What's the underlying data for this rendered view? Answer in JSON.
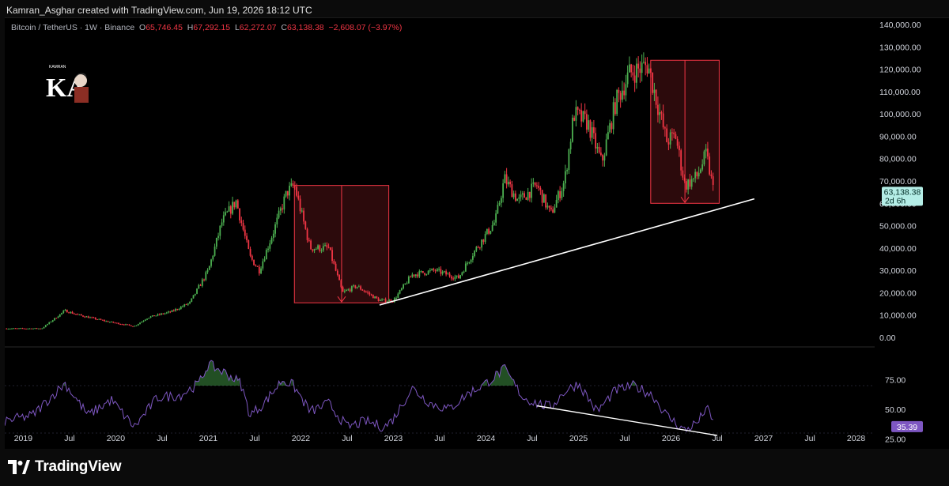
{
  "attribution": "Kamran_Asghar created with TradingView.com, Jun 19, 2026 18:12 UTC",
  "legend": {
    "symbol": "Bitcoin / TetherUS · 1W · Binance",
    "o_label": "O",
    "o_value": "65,746.45",
    "h_label": "H",
    "h_value": "67,292.15",
    "l_label": "L",
    "l_value": "62,272.07",
    "c_label": "C",
    "c_value": "63,138.38",
    "change": "−2,608.07 (−3.97%)"
  },
  "price_badge": {
    "price": "63,138.38",
    "countdown": "2d 6h",
    "color": "#26a69a"
  },
  "rsi_badge": {
    "value": "35.39",
    "color": "#7e57c2"
  },
  "footer": {
    "brand": "TradingView"
  },
  "logo": {
    "text": "KA",
    "small": "KAMRAN"
  },
  "colors": {
    "up": "#4caf50",
    "down": "#f23645",
    "rsi": "#7e57c2",
    "box": "#f23645",
    "trendline": "#ffffff"
  },
  "chart_data": [
    {
      "type": "candlestick",
      "title": "Bitcoin / TetherUS · 1W · Binance",
      "ylim": [
        0,
        140000
      ],
      "y_ticks": [
        "140,000.00",
        "130,000.00",
        "120,000.00",
        "110,000.00",
        "100,000.00",
        "90,000.00",
        "80,000.00",
        "70,000.00",
        "60,000.00",
        "50,000.00",
        "40,000.00",
        "30,000.00",
        "20,000.00",
        "10,000.00",
        "0.00"
      ],
      "x_range": [
        2018.8,
        2028.2
      ],
      "x_ticks": [
        {
          "label": "2019",
          "t": 2019.0
        },
        {
          "label": "Jul",
          "t": 2019.5
        },
        {
          "label": "2020",
          "t": 2020.0
        },
        {
          "label": "Jul",
          "t": 2020.5
        },
        {
          "label": "2021",
          "t": 2021.0
        },
        {
          "label": "Jul",
          "t": 2021.5
        },
        {
          "label": "2022",
          "t": 2022.0
        },
        {
          "label": "Jul",
          "t": 2022.5
        },
        {
          "label": "2023",
          "t": 2023.0
        },
        {
          "label": "Jul",
          "t": 2023.5
        },
        {
          "label": "2024",
          "t": 2024.0
        },
        {
          "label": "Jul",
          "t": 2024.5
        },
        {
          "label": "2025",
          "t": 2025.0
        },
        {
          "label": "Jul",
          "t": 2025.5
        },
        {
          "label": "2026",
          "t": 2026.0
        },
        {
          "label": "Jul",
          "t": 2026.5
        },
        {
          "label": "2027",
          "t": 2027.0
        },
        {
          "label": "Jul",
          "t": 2027.5
        },
        {
          "label": "2028",
          "t": 2028.0
        }
      ],
      "price_path": [
        [
          2018.8,
          4000
        ],
        [
          2019.2,
          4000
        ],
        [
          2019.45,
          12000
        ],
        [
          2019.6,
          10000
        ],
        [
          2019.9,
          7200
        ],
        [
          2020.2,
          5000
        ],
        [
          2020.35,
          9000
        ],
        [
          2020.6,
          11500
        ],
        [
          2020.8,
          15500
        ],
        [
          2021.0,
          30000
        ],
        [
          2021.15,
          52000
        ],
        [
          2021.3,
          61000
        ],
        [
          2021.45,
          36000
        ],
        [
          2021.55,
          30000
        ],
        [
          2021.7,
          47000
        ],
        [
          2021.85,
          65000
        ],
        [
          2021.93,
          68000
        ],
        [
          2022.1,
          40000
        ],
        [
          2022.3,
          40000
        ],
        [
          2022.45,
          20000
        ],
        [
          2022.6,
          23000
        ],
        [
          2022.85,
          16500
        ],
        [
          2023.0,
          16500
        ],
        [
          2023.2,
          28000
        ],
        [
          2023.45,
          30000
        ],
        [
          2023.7,
          26500
        ],
        [
          2023.85,
          37000
        ],
        [
          2024.1,
          52000
        ],
        [
          2024.2,
          71000
        ],
        [
          2024.35,
          61000
        ],
        [
          2024.55,
          68000
        ],
        [
          2024.7,
          55000
        ],
        [
          2024.85,
          70000
        ],
        [
          2024.95,
          100000
        ],
        [
          2025.1,
          96000
        ],
        [
          2025.25,
          78000
        ],
        [
          2025.4,
          105000
        ],
        [
          2025.55,
          118000
        ],
        [
          2025.75,
          122000
        ],
        [
          2025.82,
          110000
        ],
        [
          2025.95,
          88000
        ],
        [
          2026.05,
          90000
        ],
        [
          2026.15,
          68000
        ],
        [
          2026.28,
          72000
        ],
        [
          2026.38,
          82000
        ],
        [
          2026.47,
          63138
        ]
      ],
      "boxes": [
        {
          "t0": 2021.93,
          "t1": 2022.95,
          "high": 68000,
          "low": 15500
        },
        {
          "t0": 2025.78,
          "t1": 2026.52,
          "high": 124000,
          "low": 60000
        }
      ],
      "trendline": {
        "t0": 2022.85,
        "p0": 14500,
        "t1": 2026.9,
        "p1": 62000
      }
    },
    {
      "type": "line",
      "title": "",
      "ylim": [
        20,
        100
      ],
      "y_ticks": [
        "75.00",
        "50.00",
        "25.00"
      ],
      "rsi_path": [
        [
          2018.8,
          40
        ],
        [
          2019.1,
          45
        ],
        [
          2019.45,
          72
        ],
        [
          2019.7,
          45
        ],
        [
          2019.95,
          58
        ],
        [
          2020.2,
          35
        ],
        [
          2020.45,
          60
        ],
        [
          2020.7,
          62
        ],
        [
          2020.9,
          72
        ],
        [
          2021.0,
          88
        ],
        [
          2021.2,
          80
        ],
        [
          2021.35,
          72
        ],
        [
          2021.45,
          45
        ],
        [
          2021.6,
          55
        ],
        [
          2021.8,
          75
        ],
        [
          2021.92,
          70
        ],
        [
          2022.1,
          48
        ],
        [
          2022.3,
          55
        ],
        [
          2022.5,
          35
        ],
        [
          2022.7,
          40
        ],
        [
          2022.9,
          35
        ],
        [
          2023.0,
          42
        ],
        [
          2023.2,
          68
        ],
        [
          2023.4,
          55
        ],
        [
          2023.6,
          50
        ],
        [
          2023.8,
          63
        ],
        [
          2024.0,
          72
        ],
        [
          2024.2,
          84
        ],
        [
          2024.4,
          60
        ],
        [
          2024.55,
          55
        ],
        [
          2024.7,
          52
        ],
        [
          2024.85,
          65
        ],
        [
          2025.0,
          72
        ],
        [
          2025.2,
          48
        ],
        [
          2025.4,
          66
        ],
        [
          2025.6,
          70
        ],
        [
          2025.8,
          62
        ],
        [
          2025.95,
          45
        ],
        [
          2026.15,
          32
        ],
        [
          2026.3,
          40
        ],
        [
          2026.38,
          52
        ],
        [
          2026.47,
          35.39
        ]
      ],
      "trendline": {
        "t0": 2024.55,
        "v0": 53,
        "t1": 2026.5,
        "v1": 28
      }
    }
  ]
}
